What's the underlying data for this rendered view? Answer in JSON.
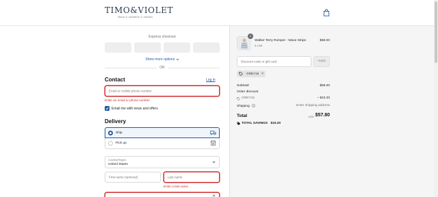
{
  "header": {
    "logo_main": "TIMO&VIOLET",
    "logo_sub": "shoes & sweaters & onesies"
  },
  "express": {
    "label": "Express checkout",
    "more_options": "Show more options",
    "or": "OR"
  },
  "contact": {
    "title": "Contact",
    "login": "Log in",
    "email_placeholder": "Email or mobile phone number",
    "email_error": "Enter an email or phone number",
    "newsletter_label": "Email me with news and offers",
    "newsletter_checked": true
  },
  "delivery": {
    "title": "Delivery",
    "options": [
      {
        "label": "Ship",
        "selected": true
      },
      {
        "label": "Pick up",
        "selected": false
      }
    ],
    "country_label": "Country/Region",
    "country_value": "United States",
    "first_name_placeholder": "First name (optional)",
    "last_name_placeholder": "Last name",
    "last_name_error": "Enter a last name"
  },
  "summary": {
    "product": {
      "name": "Walker Terry Romper - Wave Stripe",
      "variant": "6-12M",
      "price": "$68.00",
      "quantity": "1"
    },
    "discount_placeholder": "Discount code or gift card",
    "apply_label": "Apply",
    "applied_code": "GREY15",
    "subtotal_label": "Subtotal",
    "subtotal_value": "$68.00",
    "order_discount_label": "Order discount",
    "discount_code": "GREY15",
    "discount_value": "− $10.20",
    "shipping_label": "Shipping",
    "shipping_value": "Enter shipping address",
    "total_label": "Total",
    "currency": "USD",
    "total_value": "$57.80",
    "savings_label": "TOTAL SAVINGS",
    "savings_value": "$10.20"
  },
  "colors": {
    "accent": "#1f5aa6",
    "error": "#d22b2b"
  }
}
